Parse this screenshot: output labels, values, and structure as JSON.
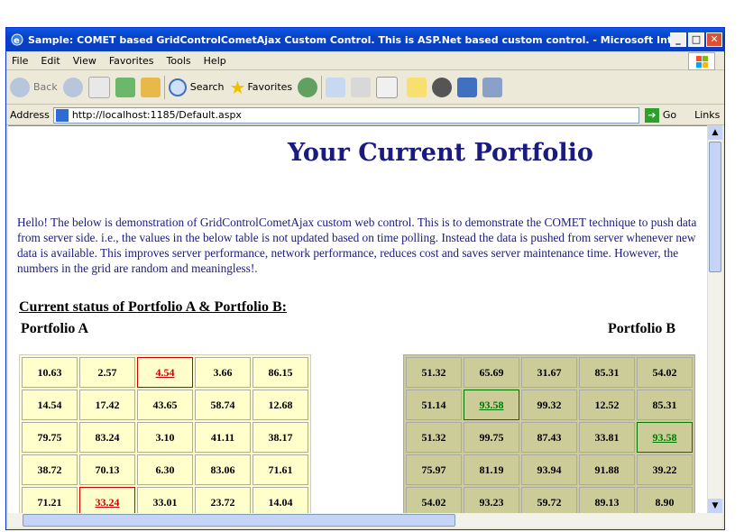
{
  "window": {
    "title": "Sample: COMET based GridControlCometAjax Custom Control. This is ASP.Net based custom control. - Microsoft Internet Explo...",
    "minimize": "_",
    "maximize": "□",
    "close": "✕"
  },
  "menubar": {
    "items": [
      "File",
      "Edit",
      "View",
      "Favorites",
      "Tools",
      "Help"
    ]
  },
  "toolbar": {
    "back": "Back",
    "search": "Search",
    "favorites": "Favorites"
  },
  "address": {
    "label": "Address",
    "url": "http://localhost:1185/Default.aspx",
    "go": "Go",
    "links": "Links"
  },
  "page": {
    "title": "Your Current Portfolio",
    "intro": "Hello! The below is demonstration of GridControlCometAjax custom web control.  This is to demonstrate the COMET technique to push data from server side.  i.e., the values in the below table is not updated based on time polling.  Instead the data is pushed from server whenever new data is available.  This improves server performance, network performance, reduces cost and saves server maintenance time.  However, the numbers in the grid are random and meaningless!.",
    "status_heading": "Current status of Portfolio A & Portfolio B:",
    "portfolio_a_label": "Portfolio A",
    "portfolio_b_label": "Portfolio B"
  },
  "portfolio_a": {
    "rows": [
      [
        "10.63",
        "2.57",
        "4.54",
        "3.66",
        "86.15"
      ],
      [
        "14.54",
        "17.42",
        "43.65",
        "58.74",
        "12.68"
      ],
      [
        "79.75",
        "83.24",
        "3.10",
        "41.11",
        "38.17"
      ],
      [
        "38.72",
        "70.13",
        "6.30",
        "83.06",
        "71.61"
      ],
      [
        "71.21",
        "33.24",
        "33.01",
        "23.72",
        "14.04"
      ]
    ],
    "highlight_color": "#cc0000"
  },
  "portfolio_b": {
    "rows": [
      [
        "51.32",
        "65.69",
        "31.67",
        "85.31",
        "54.02"
      ],
      [
        "51.14",
        "93.58",
        "99.32",
        "12.52",
        "85.31"
      ],
      [
        "51.32",
        "99.75",
        "87.43",
        "33.81",
        "93.58"
      ],
      [
        "75.97",
        "81.19",
        "93.94",
        "91.88",
        "39.22"
      ],
      [
        "54.02",
        "93.23",
        "59.72",
        "89.13",
        "8.90"
      ]
    ],
    "highlight_color": "#007700"
  },
  "colors": {
    "title_blue": "#1a1a80",
    "grid_a_bg": "#ffffcc",
    "grid_b_bg": "#cccc99"
  }
}
